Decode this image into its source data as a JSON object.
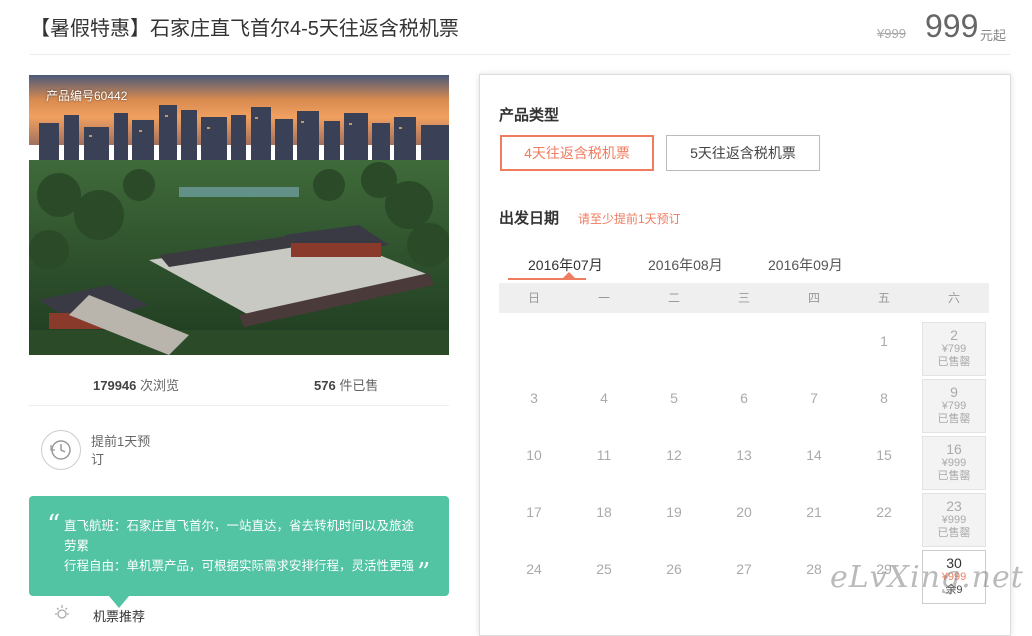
{
  "header": {
    "title": "【暑假特惠】石家庄直飞首尔4-5天往返含税机票",
    "price_old": "¥999",
    "price_now": "999",
    "price_suffix": "元起"
  },
  "product": {
    "number_label": "产品编号60442",
    "views_count": "179946",
    "views_label": "次浏览",
    "sold_count": "576",
    "sold_label": "件已售",
    "advance_text": "提前1天预订"
  },
  "quote": {
    "line1": "直飞航班：石家庄直飞首尔，一站直达，省去转机时间以及旅途劳累",
    "line2": "行程自由：单机票产品，可根据实际需求安排行程，灵活性更强",
    "open_mark": "“",
    "close_mark": "”"
  },
  "bottom_item": {
    "text": "机票推荐"
  },
  "booking": {
    "type_title": "产品类型",
    "types": [
      {
        "label": "4天往返含税机票",
        "active": true
      },
      {
        "label": "5天往返含税机票",
        "active": false
      }
    ],
    "date_title": "出发日期",
    "date_hint": "请至少提前1天预订",
    "months": [
      "2016年07月",
      "2016年08月",
      "2016年09月"
    ],
    "weekdays": [
      "日",
      "一",
      "二",
      "三",
      "四",
      "五",
      "六"
    ],
    "calendar": [
      [
        "",
        "",
        "",
        "",
        "",
        "1",
        {
          "d": "2",
          "p": "¥799",
          "s": "已售罄"
        }
      ],
      [
        "3",
        "4",
        "5",
        "6",
        "7",
        "8",
        {
          "d": "9",
          "p": "¥799",
          "s": "已售罄"
        }
      ],
      [
        "10",
        "11",
        "12",
        "13",
        "14",
        "15",
        {
          "d": "16",
          "p": "¥999",
          "s": "已售罄"
        }
      ],
      [
        "17",
        "18",
        "19",
        "20",
        "21",
        "22",
        {
          "d": "23",
          "p": "¥999",
          "s": "已售罄"
        }
      ],
      [
        "24",
        "25",
        "26",
        "27",
        "28",
        "29",
        {
          "d": "30",
          "p": "¥999",
          "s": "余9",
          "avail": true
        }
      ]
    ]
  },
  "watermark": "eLvXing.net",
  "colors": {
    "accent": "#f07c60",
    "teal": "#52c3a3"
  }
}
